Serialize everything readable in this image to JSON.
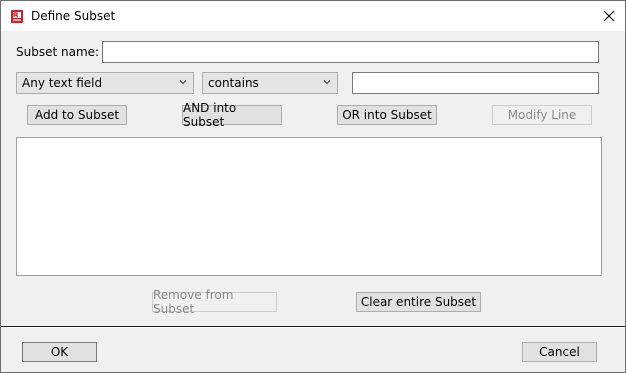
{
  "window": {
    "title": "Define Subset",
    "icon": "app-icon"
  },
  "form": {
    "subset_name_label": "Subset name:",
    "subset_name_value": "",
    "field_select": {
      "selected": "Any text field"
    },
    "operator_select": {
      "selected": "contains"
    },
    "search_value": ""
  },
  "actions": {
    "add": "Add to Subset",
    "and_into": "AND into Subset",
    "or_into": "OR into Subset",
    "modify": "Modify Line",
    "remove": "Remove from Subset",
    "clear": "Clear entire Subset"
  },
  "subset_lines": [],
  "footer": {
    "ok": "OK",
    "cancel": "Cancel"
  },
  "colors": {
    "icon_red": "#c8232c",
    "dialog_bg": "#f0f0f0"
  }
}
